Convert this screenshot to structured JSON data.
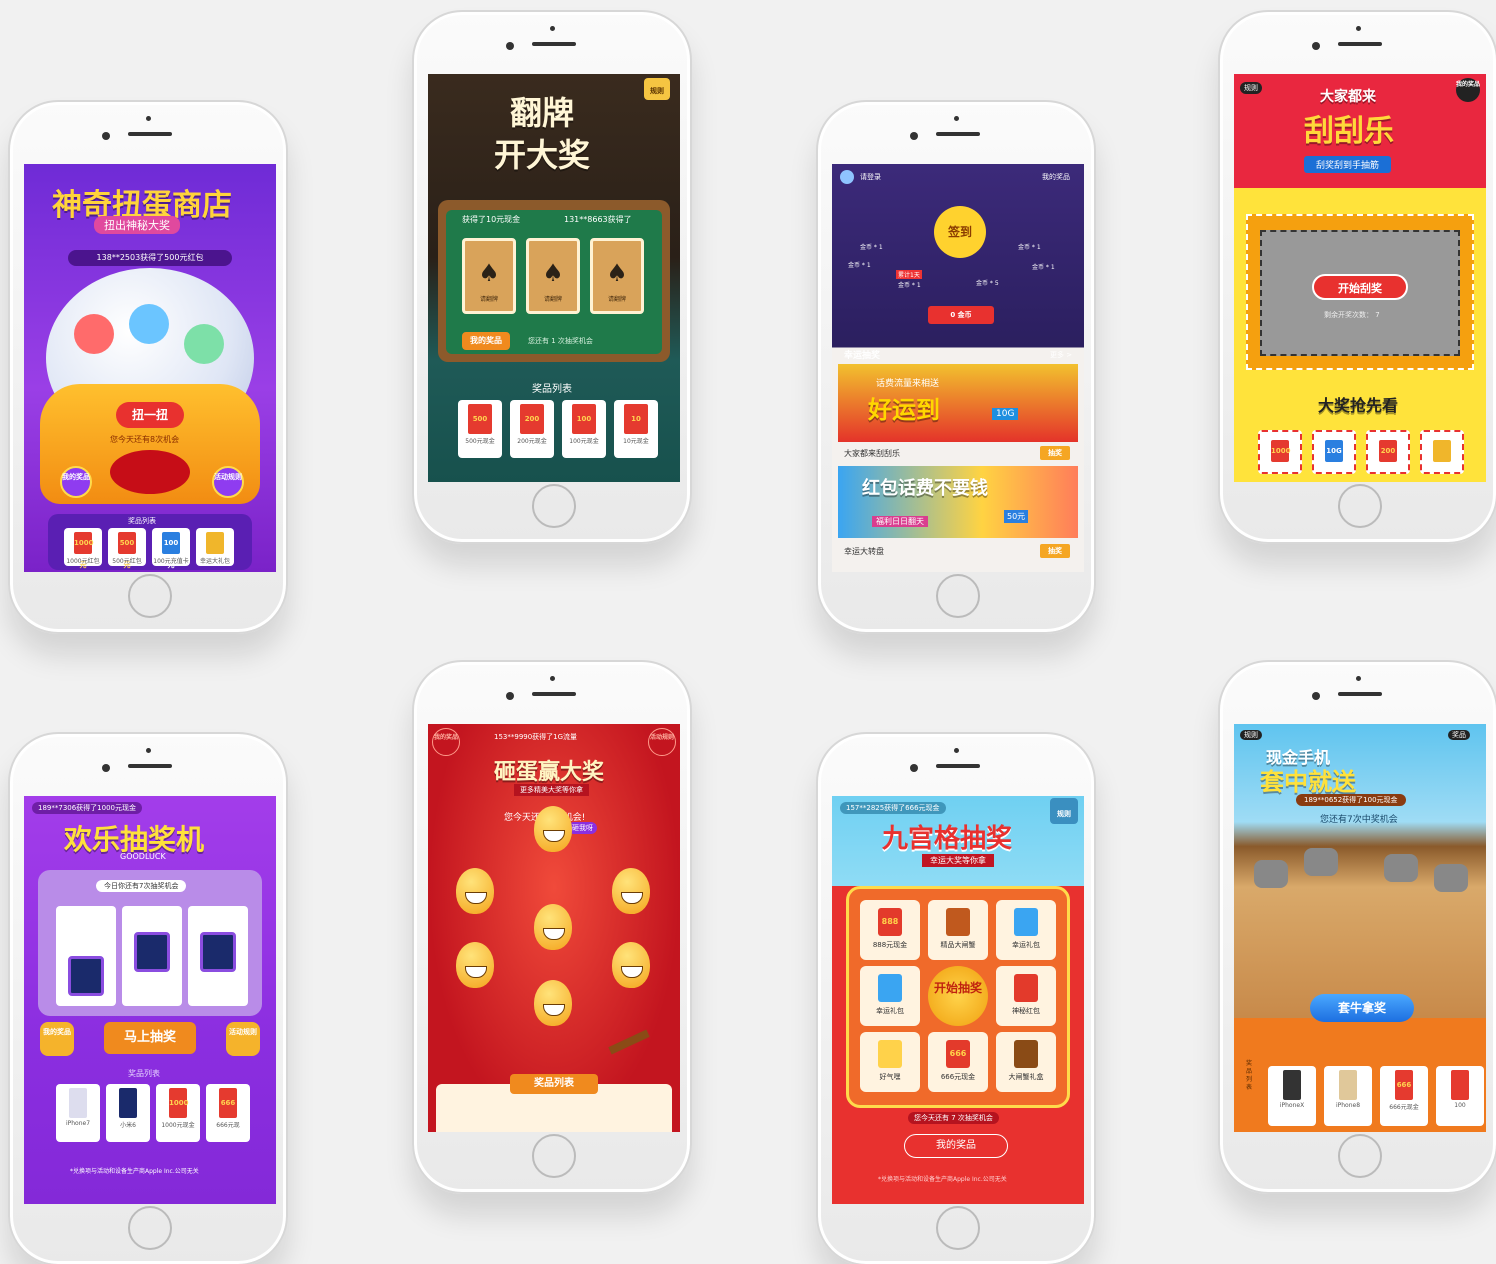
{
  "phone1": {
    "title": "神奇扭蛋商店",
    "subtitle": "扭出神秘大奖",
    "ticker": "138**2503获得了500元红包",
    "twist_button": "扭一扭",
    "chances": "您今天还有8次机会",
    "my_prizes": "我的奖品",
    "rules": "活动规则",
    "prize_list_title": "奖品列表",
    "prizes": [
      {
        "tag": "1000元",
        "label": "1000元红包"
      },
      {
        "tag": "500元",
        "label": "500元红包"
      },
      {
        "tag": "100元",
        "label": "100元充值卡"
      },
      {
        "tag": "",
        "label": "幸运大礼包"
      }
    ]
  },
  "phone2": {
    "rules": "规则",
    "title_line1": "翻牌",
    "title_line2": "开大奖",
    "ticker_left": "获得了10元现金",
    "ticker_right": "131**8663获得了",
    "card_label": "请翻牌",
    "my_prizes": "我的奖品",
    "chances": "您还有 1 次抽奖机会",
    "prize_list_title": "奖品列表",
    "prizes": [
      {
        "tag": "500",
        "label": "500元现金"
      },
      {
        "tag": "200",
        "label": "200元现金"
      },
      {
        "tag": "100",
        "label": "100元现金"
      },
      {
        "tag": "10",
        "label": "10元现金"
      }
    ]
  },
  "phone3": {
    "login": "请登录",
    "my_prizes": "我的奖品",
    "checkin": "签到",
    "coin_labels": [
      "金币 * 1",
      "金币 * 1",
      "金币 * 1",
      "金币 * 1",
      "金币 * 5",
      "金币 * 1"
    ],
    "streak": "累计1天",
    "coins": "0 金币",
    "section_title": "幸运抽奖",
    "more": "更多 >",
    "banner1_small": "话费流量来相送",
    "banner1_big": "好运到",
    "banner1_tag": "10G",
    "game1_name": "大家都来刮刮乐",
    "draw_label": "抽奖",
    "banner2_big": "红包话费不要钱",
    "banner2_small": "福利日日翻天",
    "banner2_tag": "50元",
    "game2_name": "幸运大转盘"
  },
  "phone4": {
    "rules": "规则",
    "my_prizes": "我的奖品",
    "title_small": "大家都来",
    "title_big": "刮刮乐",
    "ribbon": "刮奖刮到手抽筋",
    "start_button": "开始刮奖",
    "remaining": "剩余开奖次数： 7",
    "grand_prize": "大奖抢先看",
    "prizes": [
      "1000",
      "10G",
      "200",
      ""
    ]
  },
  "phone5": {
    "ticker": "189**7306获得了1000元现金",
    "title": "欢乐抽奖机",
    "title_en": "GOODLUCK",
    "chances": "今日你还有7次抽奖机会",
    "my_prizes": "我的奖品",
    "rules": "活动规则",
    "go_button": "马上抽奖",
    "prize_list_title": "奖品列表",
    "prizes": [
      {
        "tag": "",
        "label": "iPhone7"
      },
      {
        "tag": "",
        "label": "小米6"
      },
      {
        "tag": "1000",
        "label": "1000元现金"
      },
      {
        "tag": "666",
        "label": "666元现"
      }
    ],
    "disclaimer": "*兑换项与活动和设备生产商Apple Inc.公司无关"
  },
  "phone6": {
    "my_prizes": "我的奖品",
    "rules": "活动规则",
    "ticker": "153**9990获得了1G流量",
    "title": "砸蛋赢大奖",
    "subtitle": "更多精美大奖等你拿",
    "chances": "您今天还有3次机会!",
    "bubble": "砸我呀",
    "prize_list_title": "奖品列表"
  },
  "phone7": {
    "ticker": "157**2825获得了666元现金",
    "rules": "规则",
    "title": "九宫格抽奖",
    "subtitle": "幸运大奖等你拿",
    "start": "开始抽奖",
    "cells": [
      {
        "tag": "888",
        "label": "888元现金"
      },
      {
        "tag": "",
        "label": "精品大闸蟹"
      },
      {
        "tag": "",
        "label": "幸运礼包"
      },
      {
        "tag": "",
        "label": "幸运礼包"
      },
      {
        "tag": "",
        "label": "神秘红包"
      },
      {
        "tag": "",
        "label": "好气嘿"
      },
      {
        "tag": "666",
        "label": "666元现金"
      },
      {
        "tag": "",
        "label": "大闸蟹礼盒"
      }
    ],
    "chances": "您今天还有 7 次抽奖机会",
    "my_prizes_button": "我的奖品",
    "disclaimer": "*兑换项与活动和设备生产商Apple Inc.公司无关"
  },
  "phone8": {
    "rules": "规则",
    "my_prizes": "奖品",
    "title_line1": "现金手机",
    "title_line2": "套中就送",
    "ticker": "189**0652获得了100元现金",
    "chances": "您还有7次中奖机会",
    "lasso_button": "套牛拿奖",
    "side_label": "奖品列表",
    "prizes": [
      {
        "tag": "",
        "label": "iPhoneX"
      },
      {
        "tag": "",
        "label": "iPhone8"
      },
      {
        "tag": "666",
        "label": "666元现金"
      },
      {
        "tag": "",
        "label": "100"
      }
    ]
  }
}
